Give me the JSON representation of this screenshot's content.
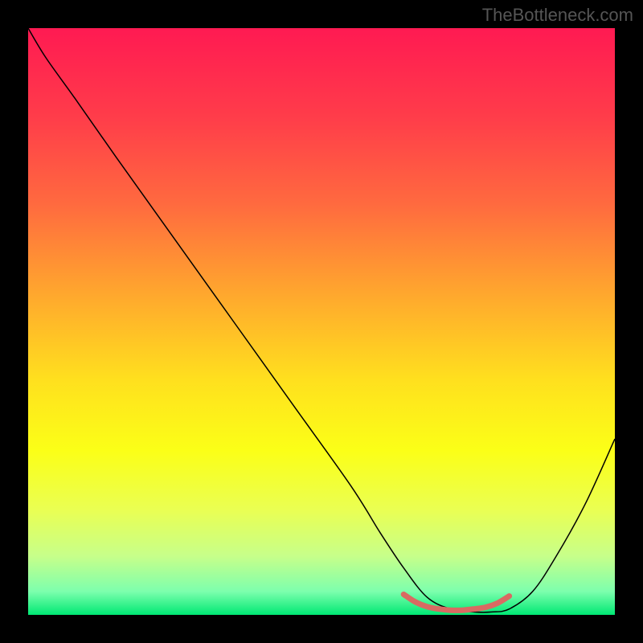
{
  "watermark": "TheBottleneck.com",
  "chart_data": {
    "type": "line",
    "title": "",
    "xlabel": "",
    "ylabel": "",
    "xlim": [
      0,
      100
    ],
    "ylim": [
      0,
      100
    ],
    "background_gradient": {
      "stops": [
        {
          "offset": 0,
          "color": "#ff1a52"
        },
        {
          "offset": 15,
          "color": "#ff3c4a"
        },
        {
          "offset": 30,
          "color": "#ff6a3f"
        },
        {
          "offset": 45,
          "color": "#ffa62e"
        },
        {
          "offset": 60,
          "color": "#ffe01e"
        },
        {
          "offset": 72,
          "color": "#fbff17"
        },
        {
          "offset": 82,
          "color": "#eaff52"
        },
        {
          "offset": 90,
          "color": "#c7ff8a"
        },
        {
          "offset": 96,
          "color": "#7dffad"
        },
        {
          "offset": 100,
          "color": "#00e874"
        }
      ]
    },
    "series": [
      {
        "name": "bottleneck-curve",
        "color": "#000000",
        "width": 1.5,
        "x": [
          0,
          3,
          8,
          15,
          25,
          35,
          45,
          55,
          60,
          64,
          68,
          72,
          76,
          79,
          82,
          86,
          90,
          95,
          100
        ],
        "y": [
          100,
          95,
          88,
          78,
          64,
          50,
          36,
          22,
          14,
          8,
          3,
          1,
          0.5,
          0.5,
          1,
          4,
          10,
          19,
          30
        ]
      },
      {
        "name": "optimal-region-marker",
        "color": "#d96a62",
        "width": 7,
        "x": [
          64,
          66,
          68,
          70,
          72,
          74,
          76,
          78,
          80,
          82
        ],
        "y": [
          3.5,
          2.2,
          1.4,
          1.0,
          0.8,
          0.8,
          1.0,
          1.3,
          2.0,
          3.2
        ]
      }
    ]
  }
}
